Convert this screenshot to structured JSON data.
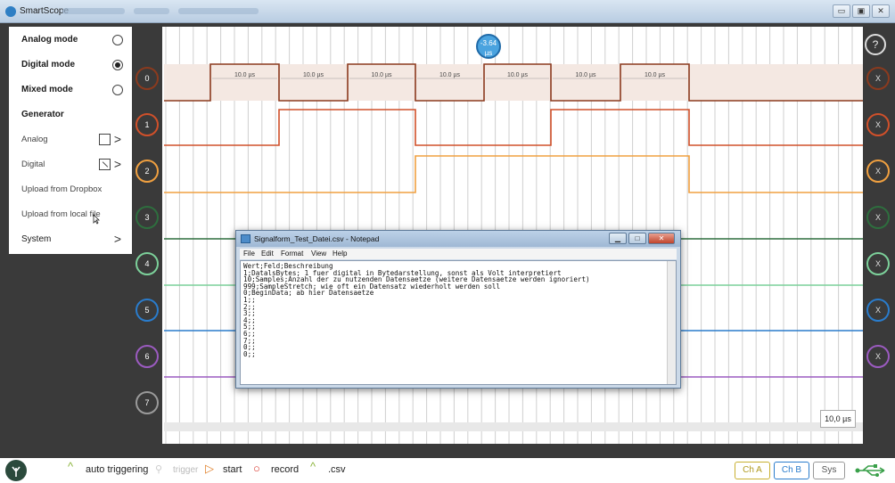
{
  "window": {
    "title": "SmartScope",
    "buttons": [
      "▭",
      "▣",
      "✕"
    ]
  },
  "sidebar": {
    "items": [
      {
        "label": "Analog mode",
        "kind": "radio",
        "selected": false
      },
      {
        "label": "Digital mode",
        "kind": "radio",
        "selected": true
      },
      {
        "label": "Mixed mode",
        "kind": "radio",
        "selected": false
      },
      {
        "label": "Generator",
        "kind": "header"
      },
      {
        "label": "Analog",
        "kind": "generator"
      },
      {
        "label": "Digital",
        "kind": "generator"
      },
      {
        "label": "Upload from Dropbox",
        "kind": "action"
      },
      {
        "label": "Upload from local file",
        "kind": "action"
      },
      {
        "label": "System",
        "kind": "submenu"
      }
    ],
    "chevron": ">"
  },
  "scope": {
    "cursor_value": "-3.64",
    "cursor_unit": "µs",
    "help_label": "?",
    "channels": [
      {
        "label": "0",
        "color": "#8b3a1e"
      },
      {
        "label": "1",
        "color": "#d0502a"
      },
      {
        "label": "2",
        "color": "#f0a040"
      },
      {
        "label": "3",
        "color": "#2e6e3e"
      },
      {
        "label": "4",
        "color": "#7cd09a"
      },
      {
        "label": "5",
        "color": "#2a7ccc"
      },
      {
        "label": "6",
        "color": "#9b5bc0"
      },
      {
        "label": "7",
        "color": "#9a9a9a"
      }
    ],
    "close_label": "X",
    "pulse_widths": [
      "10.0 µs",
      "10.0 µs",
      "10.0 µs",
      "10.0 µs",
      "10.0 µs",
      "10.0 µs",
      "10.0 µs"
    ],
    "timescale": "10,0 µs"
  },
  "notepad": {
    "title": "Signalform_Test_Datei.csv - Notepad",
    "menu": [
      "File",
      "Edit",
      "Format",
      "View",
      "Help"
    ],
    "buttons": {
      "min": "▁",
      "max": "□",
      "close": "✕"
    },
    "content": "Wert;Feld;Beschreibung\n1;DatalsBytes; 1 fuer digital in Bytedarstellung, sonst als Volt interpretiert\n10;Samples;Anzahl der zu nutzenden Datensaetze (weitere Datensaetze werden ignoriert)\n999;SampleStretch; wie oft ein Datensatz wiederholt werden soll\n0;BeginData; ab hier Datensaetze\n1;;\n2;;\n3;;\n4;;\n5;;\n6;;\n7;;\n0;;\n0;;"
  },
  "bottombar": {
    "auto_triggering": "auto triggering",
    "trigger": "trigger",
    "start": "start",
    "record": "record",
    "csv": ".csv",
    "ch_a": "Ch A",
    "ch_b": "Ch B",
    "sys": "Sys",
    "accent_green": "#8ab33a",
    "accent_orange": "#e0802a",
    "accent_red": "#d9342a",
    "accent_blue": "#2a7ccc"
  }
}
